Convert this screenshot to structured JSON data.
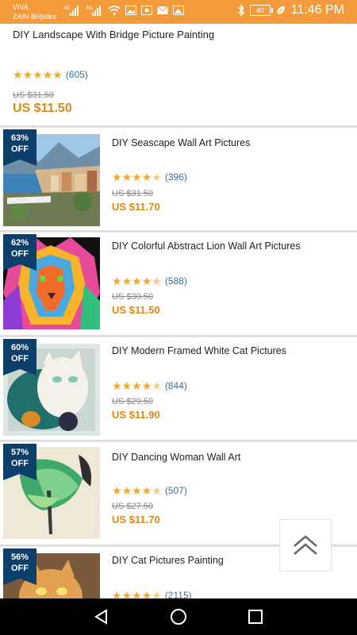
{
  "status": {
    "carrier1": "VIVA",
    "carrier2": "ZAIN BH|Idea",
    "signal1": "4G",
    "signal2": "3G",
    "battery": "40",
    "time": "11:46 PM"
  },
  "accent": "#f39a3a",
  "price_color": "#d98a17",
  "badge_color": "#0c3f6a",
  "first_item": {
    "title": "DIY Landscape With Bridge Picture Painting",
    "rating_count": "(605)",
    "old_price": "US $31.50",
    "price": "US $11.50"
  },
  "products": [
    {
      "badge_pct": "63%",
      "badge_off": "OFF",
      "title": "DIY Seascape Wall Art Pictures",
      "rating_count": "(396)",
      "old_price": "US $31.50",
      "price": "US $11.70",
      "image": "seascape-painting"
    },
    {
      "badge_pct": "62%",
      "badge_off": "OFF",
      "title": "DIY Colorful Abstract Lion Wall Art Pictures",
      "rating_count": "(588)",
      "old_price": "US $30.50",
      "price": "US $11.50",
      "image": "lion-painting"
    },
    {
      "badge_pct": "60%",
      "badge_off": "OFF",
      "title": "DIY Modern Framed White Cat Pictures",
      "rating_count": "(844)",
      "old_price": "US $29.50",
      "price": "US $11.90",
      "image": "cat-painting"
    },
    {
      "badge_pct": "57%",
      "badge_off": "OFF",
      "title": "DIY Dancing Woman Wall Art",
      "rating_count": "(507)",
      "old_price": "US $27.50",
      "price": "US $11.70",
      "image": "dancing-woman-painting"
    },
    {
      "badge_pct": "56%",
      "badge_off": "OFF",
      "title": "DIY Cat Pictures Painting",
      "rating_count": "(2115)",
      "old_price": "",
      "price": "",
      "image": "cat-pictures-painting"
    }
  ]
}
